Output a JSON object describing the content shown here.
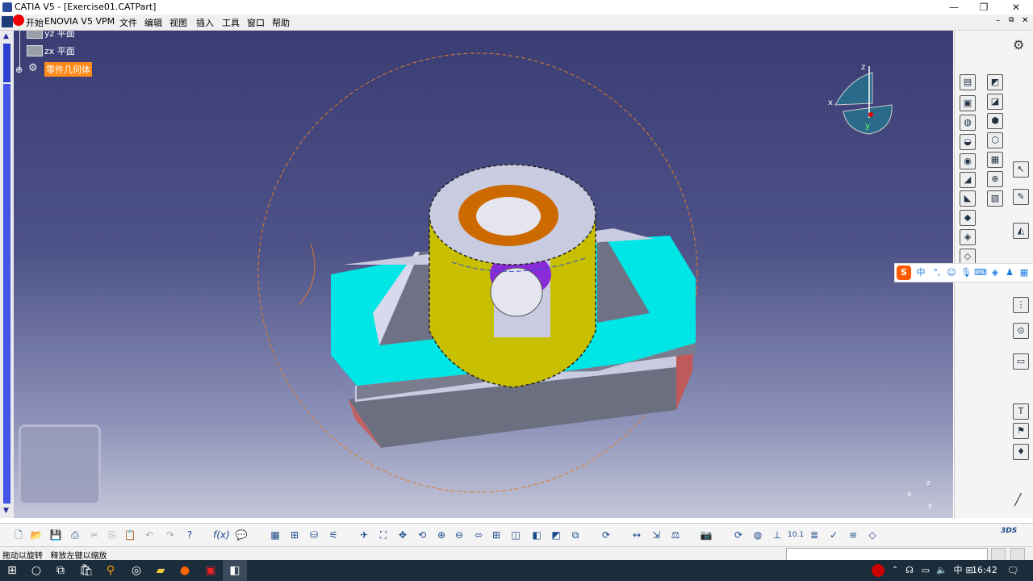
{
  "window": {
    "title": "CATIA V5 - [Exercise01.CATPart]",
    "minimize": "—",
    "maximize": "❐",
    "close": "✕"
  },
  "menubar": {
    "items": [
      "开始",
      "ENOVIA V5 VPM",
      "文件",
      "编辑",
      "视图",
      "插入",
      "工具",
      "窗口",
      "帮助"
    ]
  },
  "tree": {
    "items": [
      {
        "label": "yz 平面"
      },
      {
        "label": "zx 平面"
      },
      {
        "label": "零件几何体"
      }
    ]
  },
  "compass": {
    "x_label": "x",
    "y_label": "y",
    "z_label": "z"
  },
  "axis_indicator": {
    "x": "x",
    "y": "y",
    "z": "z"
  },
  "ime": {
    "mode": "中"
  },
  "status": {
    "text": "拖动以旋转   释放左键以缩放"
  },
  "taskbar": {
    "time": "16:42",
    "ime": "中"
  },
  "colors": {
    "accent_selection": "#ff8c1a",
    "viewport_top": "#3a3d73",
    "cyan_face": "#00e5e5",
    "yellow_face": "#c8c000",
    "purple_face": "#8020d0"
  }
}
